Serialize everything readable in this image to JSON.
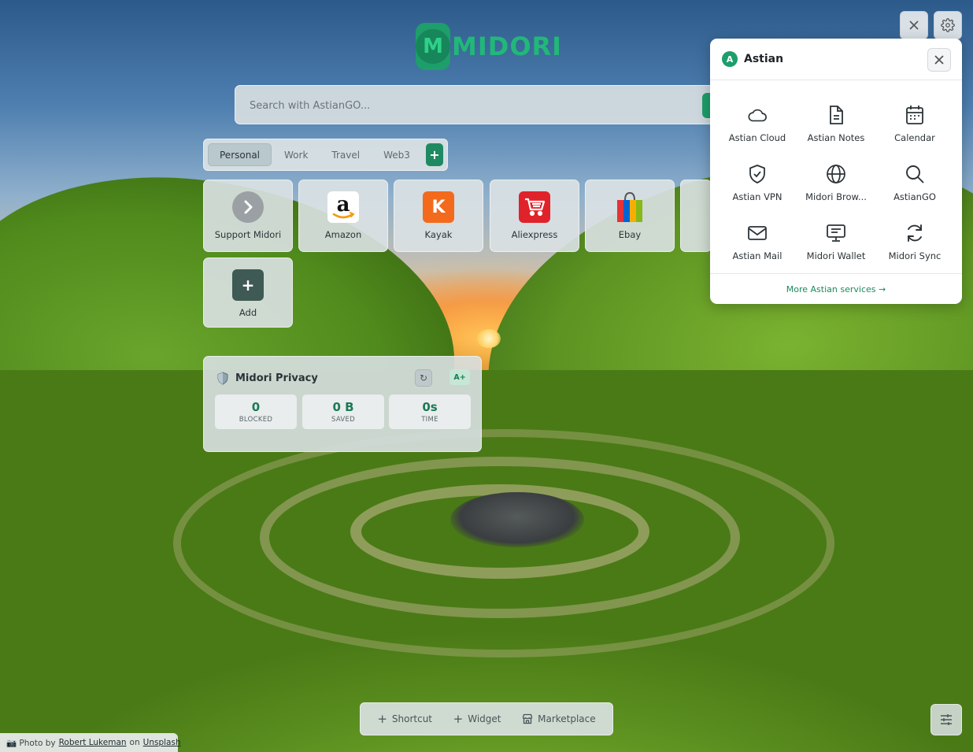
{
  "logo": {
    "text": "MIDORI",
    "mark": "M"
  },
  "search": {
    "placeholder": "Search with AstianGO..."
  },
  "tabs": {
    "items": [
      {
        "label": "Personal",
        "active": true
      },
      {
        "label": "Work",
        "active": false
      },
      {
        "label": "Travel",
        "active": false
      },
      {
        "label": "Web3",
        "active": false
      }
    ],
    "add_label": "+"
  },
  "shortcuts": [
    {
      "label": "Support Midori",
      "icon": "chevron-right-icon"
    },
    {
      "label": "Amazon",
      "icon": "amazon-icon",
      "glyph": "a"
    },
    {
      "label": "Kayak",
      "icon": "kayak-icon",
      "glyph": "K"
    },
    {
      "label": "Aliexpress",
      "icon": "aliexpress-cart-icon"
    },
    {
      "label": "Ebay",
      "icon": "ebay-bag-icon"
    },
    {
      "label": "Add",
      "icon": "plus-icon",
      "glyph": "+"
    }
  ],
  "privacy": {
    "title": "Midori Privacy",
    "grade": "A+",
    "stats": [
      {
        "value": "0",
        "label": "BLOCKED"
      },
      {
        "value": "0 B",
        "label": "SAVED"
      },
      {
        "value": "0s",
        "label": "TIME"
      }
    ]
  },
  "astian_panel": {
    "badge": "A",
    "title": "Astian",
    "services": [
      {
        "label": "Astian Cloud",
        "icon": "cloud-icon"
      },
      {
        "label": "Astian Notes",
        "icon": "document-icon"
      },
      {
        "label": "Calendar",
        "icon": "calendar-icon"
      },
      {
        "label": "Astian VPN",
        "icon": "shield-check-icon"
      },
      {
        "label": "Midori Brow...",
        "icon": "globe-icon"
      },
      {
        "label": "AstianGO",
        "icon": "search-icon"
      },
      {
        "label": "Astian Mail",
        "icon": "mail-icon"
      },
      {
        "label": "Midori Wallet",
        "icon": "wallet-monitor-icon"
      },
      {
        "label": "Midori Sync",
        "icon": "sync-icon"
      }
    ],
    "more_label": "More Astian services →"
  },
  "toolbar": {
    "shortcut_label": "Shortcut",
    "widget_label": "Widget",
    "marketplace_label": "Marketplace"
  },
  "credit": {
    "prefix": "📷 Photo by",
    "author": "Robert Lukeman",
    "middle": "on",
    "site": "Unsplash"
  },
  "colors": {
    "accent": "#1d9e6a",
    "accent_dark": "#1f8a62",
    "panel_bg": "#ffffff"
  }
}
